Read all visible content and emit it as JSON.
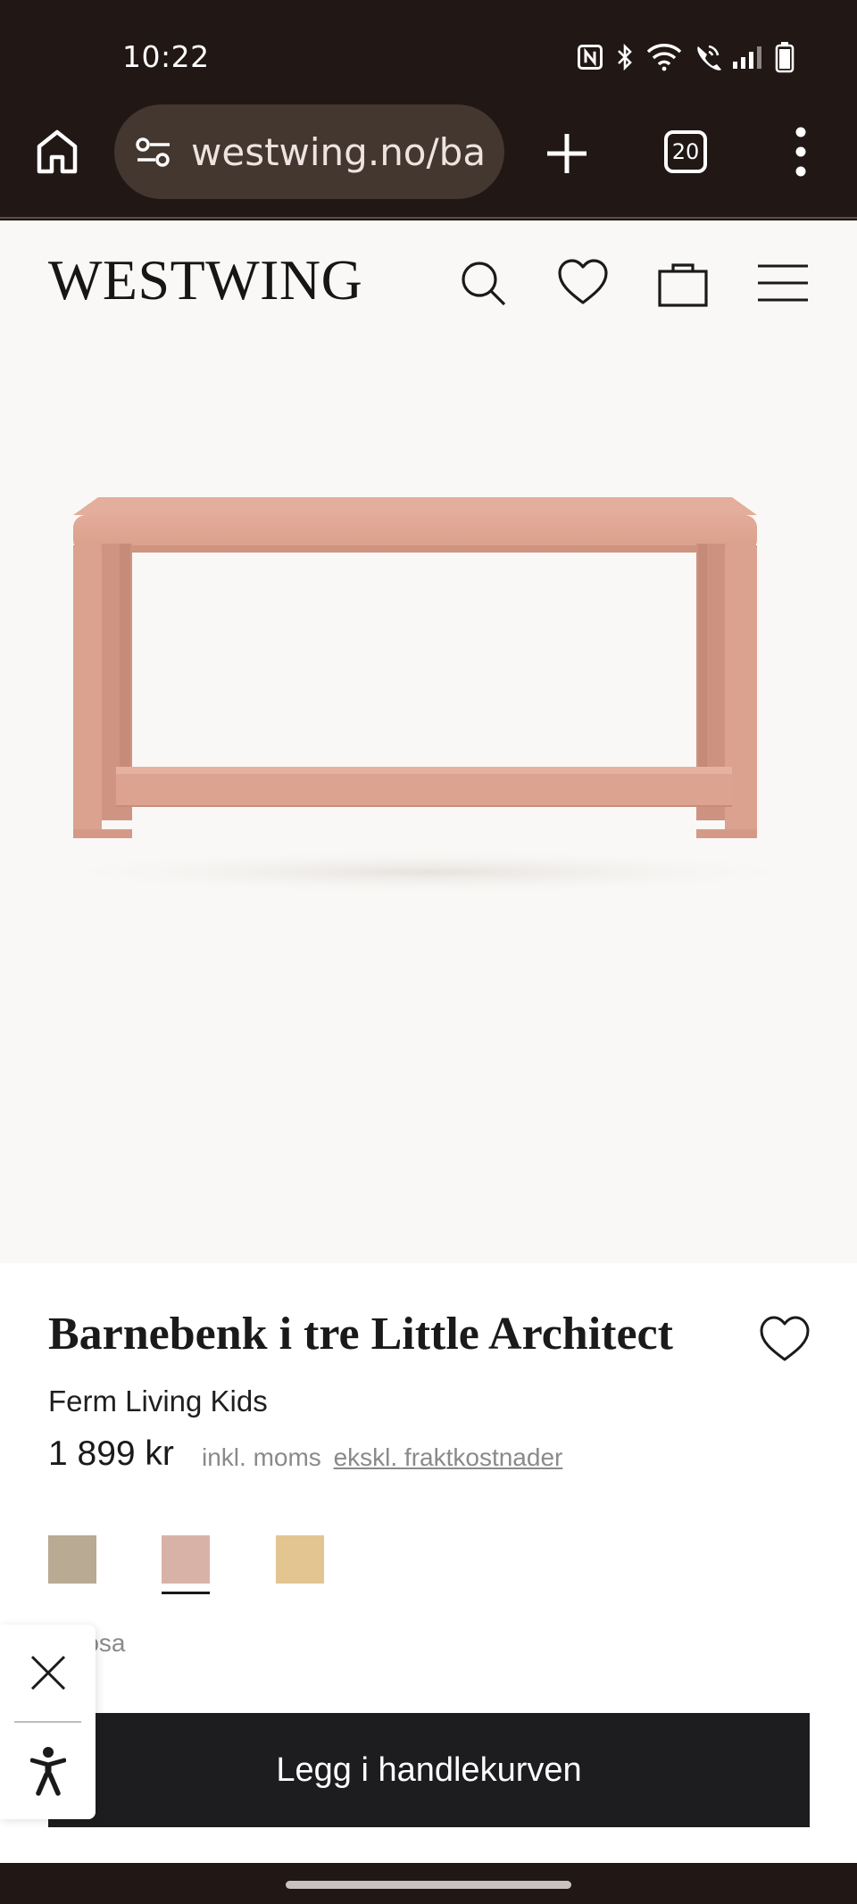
{
  "status_bar": {
    "time": "10:22",
    "icons": [
      "nfc-icon",
      "bluetooth-icon",
      "wifi-icon",
      "wifi-calling-icon",
      "signal-icon",
      "battery-icon"
    ]
  },
  "browser": {
    "url": "westwing.no/barr",
    "tab_count": "20",
    "icons": [
      "home-icon",
      "site-settings-icon",
      "plus-icon",
      "tabs-icon",
      "more-vert-icon"
    ]
  },
  "site_header": {
    "logo": "WESTWING",
    "icons": [
      "search-icon",
      "heart-icon",
      "bag-icon",
      "hamburger-menu-icon"
    ]
  },
  "product": {
    "title": "Barnebenk i tre Little Architect",
    "brand": "Ferm Living Kids",
    "price": "1 899 kr",
    "price_note": "inkl. moms",
    "shipping_link": "ekskl. fraktkostnader",
    "swatches": [
      {
        "name": "swatch-grey",
        "color": "#b8aa93"
      },
      {
        "name": "swatch-rose",
        "color": "#d9b2a7",
        "selected": true
      },
      {
        "name": "swatch-yellow",
        "color": "#e3c591"
      }
    ],
    "selected_color_label": "rosa",
    "add_to_cart_label": "Legg i handlekurven"
  },
  "colors": {
    "chrome_bg": "#211715",
    "page_bg": "#f9f8f6",
    "bench_pink": "#dca28f",
    "cart_button": "#1d1d20"
  }
}
